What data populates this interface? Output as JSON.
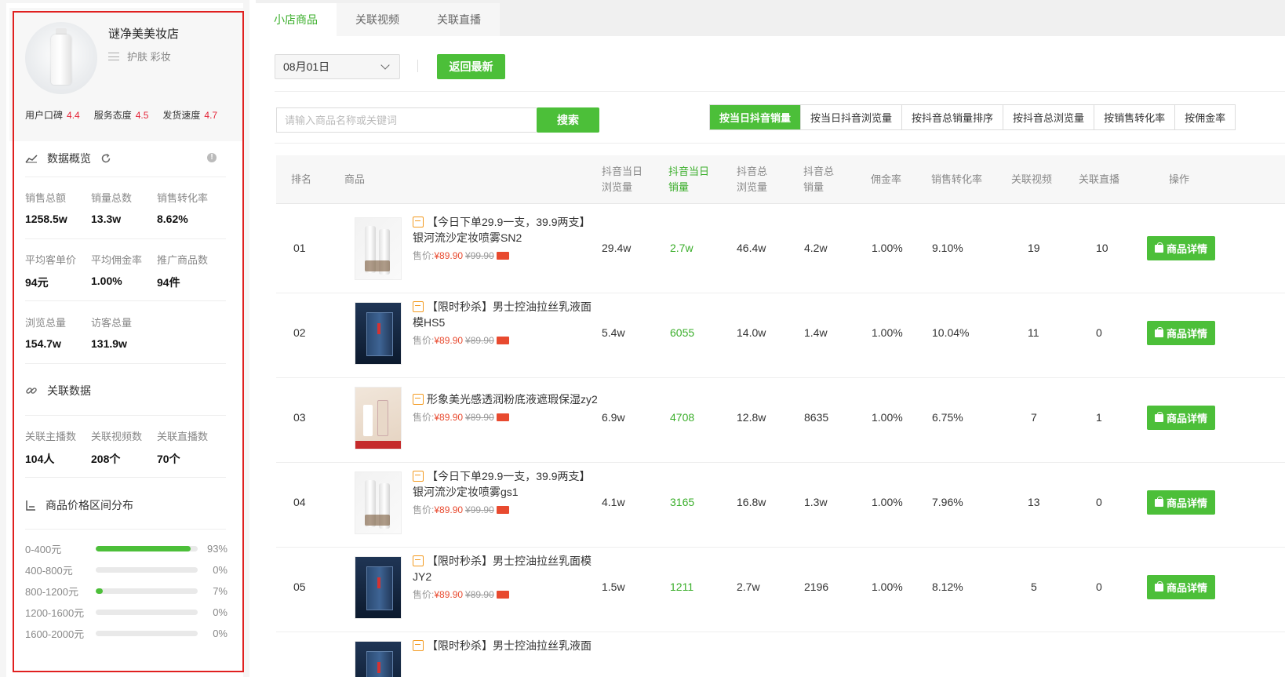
{
  "store": {
    "name": "谜净美美妆店",
    "category": "护肤 彩妆",
    "ratings": [
      {
        "label": "用户口碑",
        "score": "4.4"
      },
      {
        "label": "服务态度",
        "score": "4.5"
      },
      {
        "label": "发货速度",
        "score": "4.7"
      }
    ]
  },
  "overview": {
    "title": "数据概览",
    "stats_rows": [
      [
        {
          "label": "销售总额",
          "value": "1258.5w"
        },
        {
          "label": "销量总数",
          "value": "13.3w"
        },
        {
          "label": "销售转化率",
          "value": "8.62%"
        }
      ],
      [
        {
          "label": "平均客单价",
          "value": "94元"
        },
        {
          "label": "平均佣金率",
          "value": "1.00%"
        },
        {
          "label": "推广商品数",
          "value": "94件"
        }
      ],
      [
        {
          "label": "浏览总量",
          "value": "154.7w"
        },
        {
          "label": "访客总量",
          "value": "131.9w"
        }
      ]
    ]
  },
  "related": {
    "title": "关联数据",
    "stats": [
      {
        "label": "关联主播数",
        "value": "104人"
      },
      {
        "label": "关联视频数",
        "value": "208个"
      },
      {
        "label": "关联直播数",
        "value": "70个"
      }
    ]
  },
  "price_dist": {
    "title": "商品价格区间分布",
    "rows": [
      {
        "range": "0-400元",
        "pct": "93%",
        "fraction": 0.93
      },
      {
        "range": "400-800元",
        "pct": "0%",
        "fraction": 0
      },
      {
        "range": "800-1200元",
        "pct": "7%",
        "fraction": 0.07
      },
      {
        "range": "1200-1600元",
        "pct": "0%",
        "fraction": 0
      },
      {
        "range": "1600-2000元",
        "pct": "0%",
        "fraction": 0
      }
    ]
  },
  "tabs": [
    {
      "label": "小店商品",
      "active": true
    },
    {
      "label": "关联视频",
      "active": false
    },
    {
      "label": "关联直播",
      "active": false
    }
  ],
  "filters": {
    "date_value": "08月01日",
    "refresh_label": "返回最新",
    "search_placeholder": "请输入商品名称或关键词",
    "search_label": "搜索",
    "sort_options": [
      {
        "label": "按当日抖音销量",
        "active": true
      },
      {
        "label": "按当日抖音浏览量",
        "active": false
      },
      {
        "label": "按抖音总销量排序",
        "active": false
      },
      {
        "label": "按抖音总浏览量",
        "active": false
      },
      {
        "label": "按销售转化率",
        "active": false
      },
      {
        "label": "按佣金率",
        "active": false
      }
    ]
  },
  "table": {
    "headers": {
      "rank": "排名",
      "product": "商品",
      "day_views_1": "抖音当日",
      "day_views_2": "浏览量",
      "day_sales_1": "抖音当日",
      "day_sales_2": "销量",
      "total_views_1": "抖音总",
      "total_views_2": "浏览量",
      "total_sales_1": "抖音总",
      "total_sales_2": "销量",
      "commission": "佣金率",
      "conversion": "销售转化率",
      "videos": "关联视频",
      "lives": "关联直播",
      "action": "操作"
    },
    "price_prefix": "售价:",
    "detail_label": "商品详情",
    "rows": [
      {
        "rank": "01",
        "image": "white",
        "title_line1": "【今日下单29.9一支，39.9两支】",
        "title_line2": "银河流沙定妆喷雾SN2",
        "price": "¥89.90",
        "old_price": "¥99.90",
        "day_views": "29.4w",
        "day_sales": "2.7w",
        "total_views": "46.4w",
        "total_sales": "4.2w",
        "commission": "1.00%",
        "conversion": "9.10%",
        "videos": "19",
        "lives": "10"
      },
      {
        "rank": "02",
        "image": "blue",
        "title_line1": "【限时秒杀】男士控油拉丝乳液面",
        "title_line2": "模HS5",
        "price": "¥89.90",
        "old_price": "¥89.90",
        "day_views": "5.4w",
        "day_sales": "6055",
        "total_views": "14.0w",
        "total_sales": "1.4w",
        "commission": "1.00%",
        "conversion": "10.04%",
        "videos": "11",
        "lives": "0"
      },
      {
        "rank": "03",
        "image": "beige",
        "title_line1": "形象美光感透润粉底液遮瑕保湿zy2",
        "title_line2": "",
        "price": "¥89.90",
        "old_price": "¥89.90",
        "day_views": "6.9w",
        "day_sales": "4708",
        "total_views": "12.8w",
        "total_sales": "8635",
        "commission": "1.00%",
        "conversion": "6.75%",
        "videos": "7",
        "lives": "1"
      },
      {
        "rank": "04",
        "image": "white",
        "title_line1": "【今日下单29.9一支，39.9两支】",
        "title_line2": "银河流沙定妆喷雾gs1",
        "price": "¥89.90",
        "old_price": "¥99.90",
        "day_views": "4.1w",
        "day_sales": "3165",
        "total_views": "16.8w",
        "total_sales": "1.3w",
        "commission": "1.00%",
        "conversion": "7.96%",
        "videos": "13",
        "lives": "0"
      },
      {
        "rank": "05",
        "image": "blue",
        "title_line1": "【限时秒杀】男士控油拉丝乳面模",
        "title_line2": "JY2",
        "price": "¥89.90",
        "old_price": "¥89.90",
        "day_views": "1.5w",
        "day_sales": "1211",
        "total_views": "2.7w",
        "total_sales": "2196",
        "commission": "1.00%",
        "conversion": "8.12%",
        "videos": "5",
        "lives": "0"
      },
      {
        "rank": "",
        "image": "blue",
        "title_line1": "【限时秒杀】男士控油拉丝乳液面",
        "title_line2": "",
        "price": "",
        "old_price": "",
        "day_views": "",
        "day_sales": "",
        "total_views": "",
        "total_sales": "",
        "commission": "",
        "conversion": "",
        "videos": "",
        "lives": ""
      }
    ]
  },
  "colors": {
    "accent_green": "#4cbf39",
    "score_red": "#e5263a",
    "price_red": "#e84a2f",
    "highlight_outline": "#e0201f"
  }
}
